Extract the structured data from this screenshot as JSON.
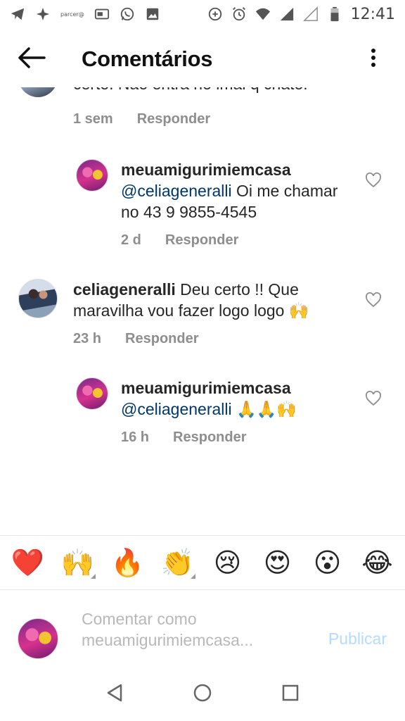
{
  "status_bar": {
    "time": "12:41",
    "small_label": "parcer@",
    "icons": [
      "telegram-icon",
      "sparkle-icon",
      "parcer-icon",
      "vpn-card-icon",
      "whatsapp-icon",
      "image-icon",
      "data-saver-icon",
      "alarm-icon",
      "wifi-icon",
      "signal-icon",
      "signal-empty-icon",
      "battery-icon"
    ]
  },
  "header": {
    "title": "Comentários",
    "back_icon": "arrow-left-icon",
    "more_icon": "more-vertical-icon"
  },
  "comments": {
    "top_partial": {
      "text": "certo. Não entra no imai  q chato!",
      "time": "1 sem",
      "reply": "Responder"
    },
    "items": [
      {
        "username": "meuamigurimiemcasa",
        "mention": "@celiageneralli",
        "text": " Oi me chamar no 43 9 9855-4545",
        "time": "2 d",
        "reply": "Responder"
      },
      {
        "username": "celiageneralli",
        "text": " Deu certo !! Que maravilha  vou fazer logo logo 🙌",
        "time": "23 h",
        "reply": "Responder"
      },
      {
        "username": "meuamigurimiemcasa",
        "mention": "@celiageneralli",
        "text": " 🙏🙏🙌",
        "time": "16 h",
        "reply": "Responder"
      }
    ]
  },
  "emoji_bar": [
    "❤️",
    "🙌",
    "🔥",
    "👏",
    "😢",
    "😍",
    "😮",
    "😂"
  ],
  "composer": {
    "placeholder": "Comentar como meuamigurimiemcasa...",
    "publish": "Publicar"
  },
  "nav": [
    "back-triangle-icon",
    "home-circle-icon",
    "recents-square-icon"
  ]
}
